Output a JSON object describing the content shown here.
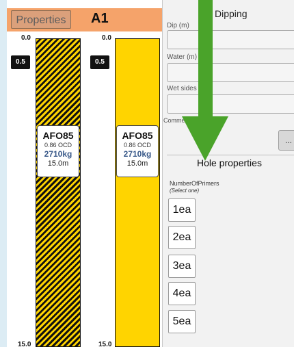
{
  "header": {
    "properties_button": "Properties",
    "hole_name": "A1"
  },
  "depth_scale": {
    "top": "0.0",
    "bottom": "15.0",
    "marker": "0.5"
  },
  "columns": [
    {
      "code": "AFO85",
      "ocd": "0.86 OCD",
      "weight": "2710kg",
      "length": "15.0m",
      "fill": "hatched"
    },
    {
      "code": "AFO85",
      "ocd": "0.86 OCD",
      "weight": "2710kg",
      "length": "15.0m",
      "fill": "solid"
    }
  ],
  "dipping": {
    "title": "Dipping",
    "dip_label": "Dip (m)",
    "water_label": "Water (m)",
    "wet_sides_label": "Wet sides (",
    "comments_label": "Comme",
    "more_button": "..."
  },
  "hole_properties": {
    "title": "Hole properties",
    "number_of_primers_label": "NumberOfPrimers",
    "select_hint": "(Select one)",
    "options": [
      "1ea",
      "2ea",
      "3ea",
      "4ea",
      "5ea"
    ]
  },
  "colors": {
    "header_bg": "#f5a36a",
    "column_fill": "#ffd400",
    "arrow": "#4aa32a",
    "panel_bg": "#f2f2f2"
  },
  "icons": {
    "overlay_arrow": "down-arrow-icon"
  }
}
